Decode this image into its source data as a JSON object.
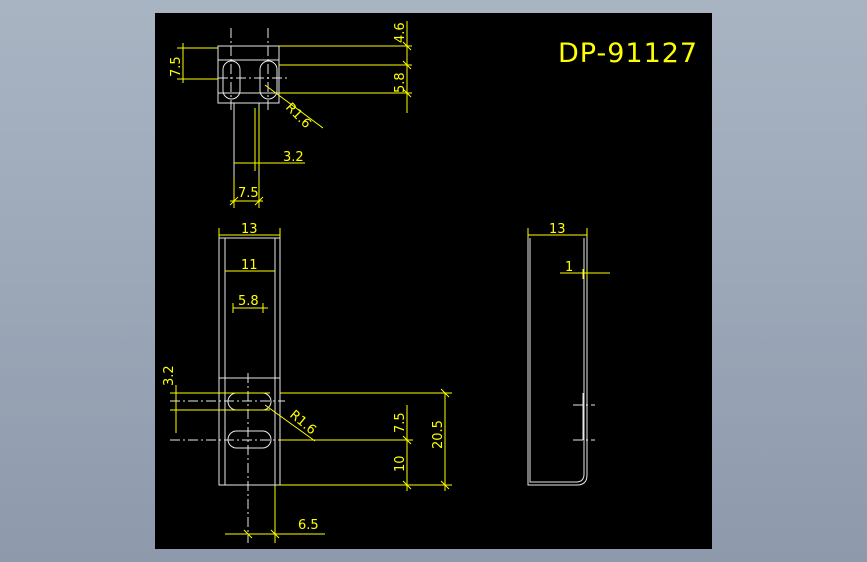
{
  "title": "DP-91127",
  "top_view": {
    "dims": {
      "h1": "4.6",
      "h2": "5.8",
      "left_h": "7.5",
      "radius": "R1.6",
      "slot_w": "3.2",
      "base_w": "7.5"
    }
  },
  "front_view": {
    "dims": {
      "w13": "13",
      "w11": "11",
      "w58": "5.8",
      "h32": "3.2",
      "radius": "R1.6",
      "h75": "7.5",
      "h205": "20.5",
      "h10": "10",
      "w65": "6.5"
    }
  },
  "side_view": {
    "dims": {
      "w13": "13",
      "t1": "1"
    }
  },
  "colors": {
    "dimension": "#ffff00",
    "geometry": "#e8e8e8",
    "background": "#000000",
    "frame": "#a9b4c3"
  }
}
